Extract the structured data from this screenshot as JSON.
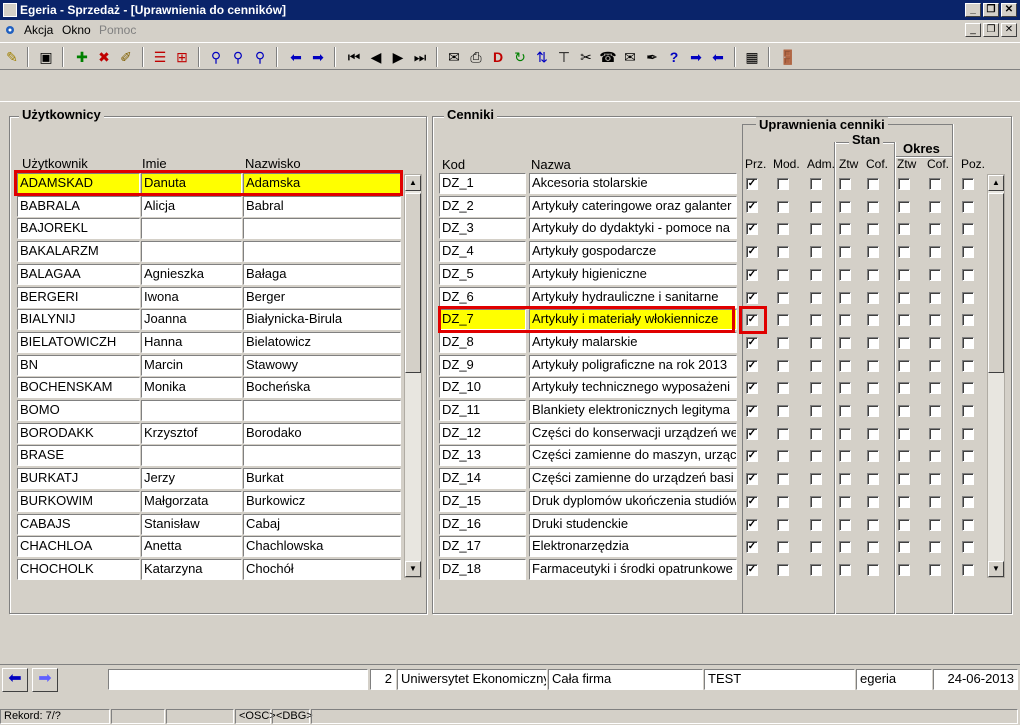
{
  "window": {
    "title": "Egeria - Sprzedaż - [Uprawnienia do cenników]"
  },
  "menu": {
    "items": [
      "Akcja",
      "Okno",
      "Pomoc"
    ]
  },
  "users_panel": {
    "title": "Użytkownicy",
    "columns": [
      "Użytkownik",
      "Imie",
      "Nazwisko"
    ],
    "rows": [
      [
        "ADAMSKAD",
        "Danuta",
        "Adamska"
      ],
      [
        "BABRALA",
        "Alicja",
        "Babral"
      ],
      [
        "BAJOREKL",
        "",
        ""
      ],
      [
        "BAKALARZM",
        "",
        ""
      ],
      [
        "BALAGAA",
        "Agnieszka",
        "Bałaga"
      ],
      [
        "BERGERI",
        "Iwona",
        "Berger"
      ],
      [
        "BIALYNIJ",
        "Joanna",
        "Białynicka-Birula"
      ],
      [
        "BIELATOWICZH",
        "Hanna",
        "Bielatowicz"
      ],
      [
        "BN",
        "Marcin",
        "Stawowy"
      ],
      [
        "BOCHENSKAM",
        "Monika",
        "Bocheńska"
      ],
      [
        "BOMO",
        "",
        ""
      ],
      [
        "BORODAKK",
        "Krzysztof",
        "Borodako"
      ],
      [
        "BRASE",
        "",
        ""
      ],
      [
        "BURKATJ",
        "Jerzy",
        "Burkat"
      ],
      [
        "BURKOWIM",
        "Małgorzata",
        "Burkowicz"
      ],
      [
        "CABAJS",
        "Stanisław",
        "Cabaj"
      ],
      [
        "CHACHLOA",
        "Anetta",
        "Chachlowska"
      ],
      [
        "CHOCHOLK",
        "Katarzyna",
        "Chochół"
      ]
    ],
    "selected_row": 0
  },
  "pricelists_panel": {
    "title": "Cenniki",
    "columns": [
      "Kod",
      "Nazwa"
    ],
    "rows": [
      [
        "DZ_1",
        "Akcesoria stolarskie"
      ],
      [
        "DZ_2",
        "Artykuły cateringowe oraz galanter"
      ],
      [
        "DZ_3",
        "Artykuły do dydaktyki - pomoce na"
      ],
      [
        "DZ_4",
        "Artykuły gospodarcze"
      ],
      [
        "DZ_5",
        "Artykuły higieniczne"
      ],
      [
        "DZ_6",
        "Artykuły hydrauliczne i sanitarne"
      ],
      [
        "DZ_7",
        "Artykuły i materiały włokiennicze"
      ],
      [
        "DZ_8",
        "Artykuły malarskie"
      ],
      [
        "DZ_9",
        "Artykuły poligraficzne na rok 2013"
      ],
      [
        "DZ_10",
        "Artykuły technicznego wyposażeni"
      ],
      [
        "DZ_11",
        "Blankiety elektronicznych legityma"
      ],
      [
        "DZ_12",
        "Części do konserwacji urządzeń we"
      ],
      [
        "DZ_13",
        "Części zamienne do maszyn, urząc"
      ],
      [
        "DZ_14",
        "Części zamienne do urządzeń basi"
      ],
      [
        "DZ_15",
        "Druk dyplomów ukończenia studiów"
      ],
      [
        "DZ_16",
        "Druki studenckie"
      ],
      [
        "DZ_17",
        "Elektronarzędzia"
      ],
      [
        "DZ_18",
        "Farmaceutyki i środki opatrunkowe"
      ]
    ],
    "selected_row": 6
  },
  "permissions": {
    "title": "Uprawnienia cenniki",
    "group_stan": "Stan",
    "group_okres": "Okres",
    "columns": [
      "Prz.",
      "Mod.",
      "Adm.",
      "Ztw",
      "Cof.",
      "Ztw",
      "Cof.",
      "Poz."
    ],
    "checked_column": 0
  },
  "status": {
    "num": "2",
    "org": "Uniwersytet Ekonomiczny",
    "scope": "Cała firma",
    "env": "TEST",
    "user": "egeria",
    "date": "24-06-2013"
  },
  "bottom": {
    "record": "Rekord: 7/?",
    "osc": "<OSC>",
    "dbg": "<DBG>"
  }
}
